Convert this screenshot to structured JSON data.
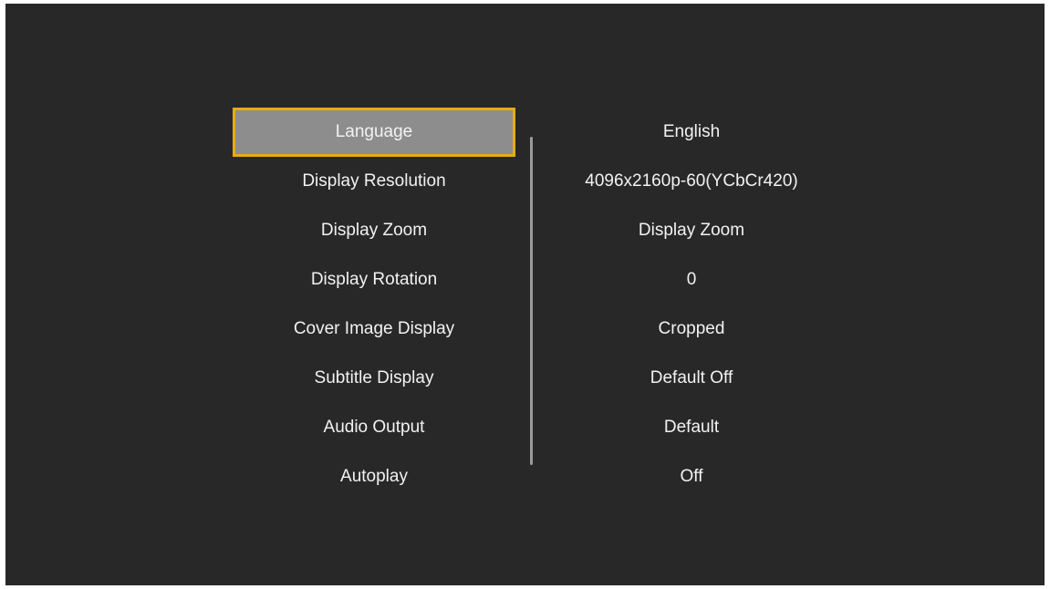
{
  "settings": {
    "items": [
      {
        "label": "Language",
        "value": "English"
      },
      {
        "label": "Display Resolution",
        "value": "4096x2160p-60(YCbCr420)"
      },
      {
        "label": "Display Zoom",
        "value": "Display Zoom"
      },
      {
        "label": "Display Rotation",
        "value": "0"
      },
      {
        "label": "Cover Image Display",
        "value": "Cropped"
      },
      {
        "label": "Subtitle Display",
        "value": "Default Off"
      },
      {
        "label": "Audio Output",
        "value": "Default"
      },
      {
        "label": "Autoplay",
        "value": "Off"
      }
    ],
    "selected_index": 0
  },
  "colors": {
    "background": "#282828",
    "text": "#f2f2f2",
    "selected_fill": "#8d8d8d",
    "focus_border": "#e6ac12",
    "scrollbar": "#9a9a9a"
  }
}
